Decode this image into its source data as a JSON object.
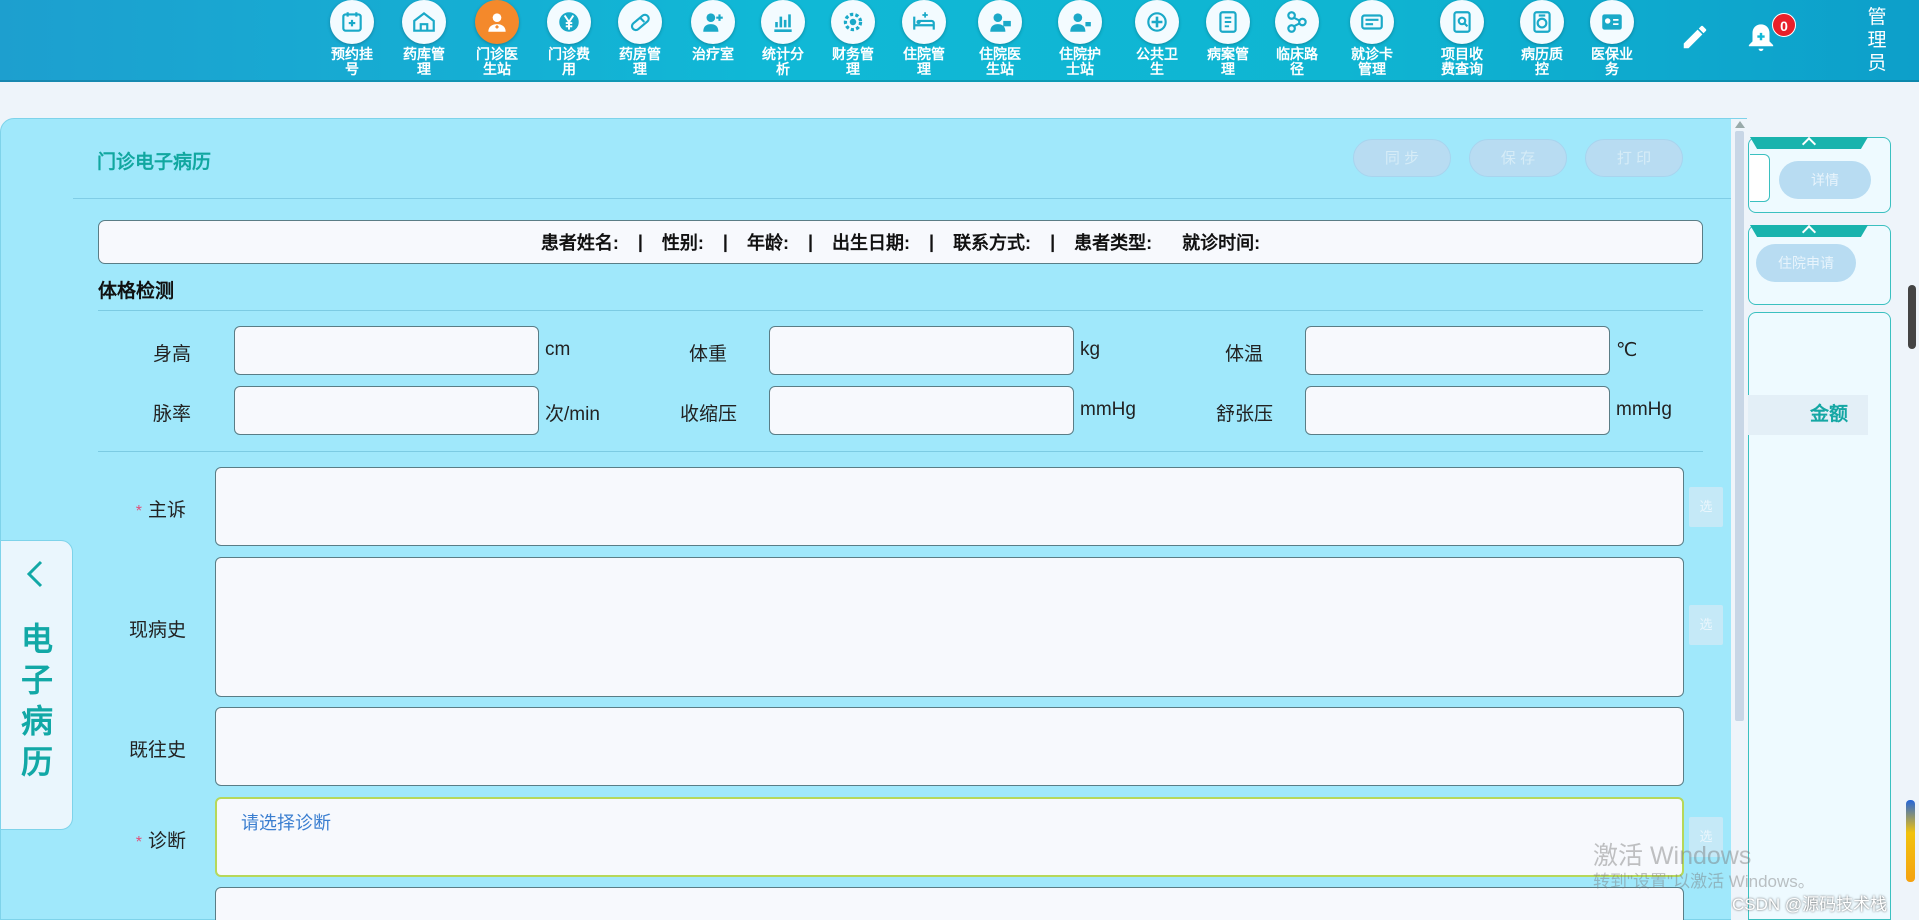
{
  "nav": {
    "items": [
      {
        "label": "预约挂号",
        "icon": "calendar-plus-icon",
        "active": false
      },
      {
        "label": "药库管理",
        "icon": "warehouse-icon",
        "active": false
      },
      {
        "label": "门诊医生站",
        "icon": "doctor-icon",
        "active": true
      },
      {
        "label": "门诊费用",
        "icon": "yen-icon",
        "active": false
      },
      {
        "label": "药房管理",
        "icon": "pill-icon",
        "active": false
      },
      {
        "label": "治疗室",
        "icon": "nurse-icon",
        "active": false
      },
      {
        "label": "统计分析",
        "icon": "bar-chart-icon",
        "active": false
      },
      {
        "label": "财务管理",
        "icon": "gear-coin-icon",
        "active": false
      },
      {
        "label": "住院管理",
        "icon": "hospital-bed-icon",
        "active": false
      },
      {
        "label": "住院医生站",
        "icon": "doctor-card-icon",
        "active": false
      },
      {
        "label": "住院护士站",
        "icon": "nurse-station-icon",
        "active": false
      },
      {
        "label": "公共卫生",
        "icon": "health-cross-icon",
        "active": false
      },
      {
        "label": "病案管理",
        "icon": "medical-record-icon",
        "active": false
      },
      {
        "label": "临床路径",
        "icon": "path-icon",
        "active": false
      },
      {
        "label": "就诊卡管理",
        "icon": "id-card-icon",
        "active": false
      },
      {
        "label": "项目收费查询",
        "icon": "search-document-icon",
        "active": false
      },
      {
        "label": "病历质控",
        "icon": "quality-control-icon",
        "active": false
      },
      {
        "label": "医保业务",
        "icon": "insurance-card-icon",
        "active": false
      }
    ],
    "notification_count": "0",
    "user": "管理员",
    "accent_active": "#f4892b"
  },
  "panel": {
    "title": "门诊电子病历",
    "buttons": {
      "sync": "同 步",
      "save": "保 存",
      "print": "打 印"
    },
    "info_fields": [
      "患者姓名:",
      "性别:",
      "年龄:",
      "出生日期:",
      "联系方式:",
      "患者类型:",
      "就诊时间:"
    ],
    "section_title": "体格检测",
    "vitals": [
      {
        "label": "身高",
        "unit": "cm",
        "value": ""
      },
      {
        "label": "体重",
        "unit": "kg",
        "value": ""
      },
      {
        "label": "体温",
        "unit": "℃",
        "value": ""
      },
      {
        "label": "脉率",
        "unit": "次/min",
        "value": ""
      },
      {
        "label": "收缩压",
        "unit": "mmHg",
        "value": ""
      },
      {
        "label": "舒张压",
        "unit": "mmHg",
        "value": ""
      }
    ],
    "text_fields": [
      {
        "label": "主诉",
        "required": true,
        "value": ""
      },
      {
        "label": "现病史",
        "required": false,
        "value": ""
      },
      {
        "label": "既往史",
        "required": false,
        "value": ""
      },
      {
        "label": "诊断",
        "required": true,
        "value": "",
        "placeholder": "请选择诊断"
      }
    ],
    "select_label": "选",
    "required_mark": "*"
  },
  "drawer": {
    "label": "电子病历"
  },
  "right": {
    "details_button": "详情",
    "admit_button": "住院申请",
    "amount_header": "金额"
  },
  "watermark": {
    "line1": "激活 Windows",
    "line2": "转到\"设置\"以激活 Windows。",
    "credit": "CSDN @源码技术栈"
  },
  "colors": {
    "panel_bg": "#a0e8fb",
    "accent_teal": "#12a8a6",
    "nav_bg": "#10b8d6"
  }
}
